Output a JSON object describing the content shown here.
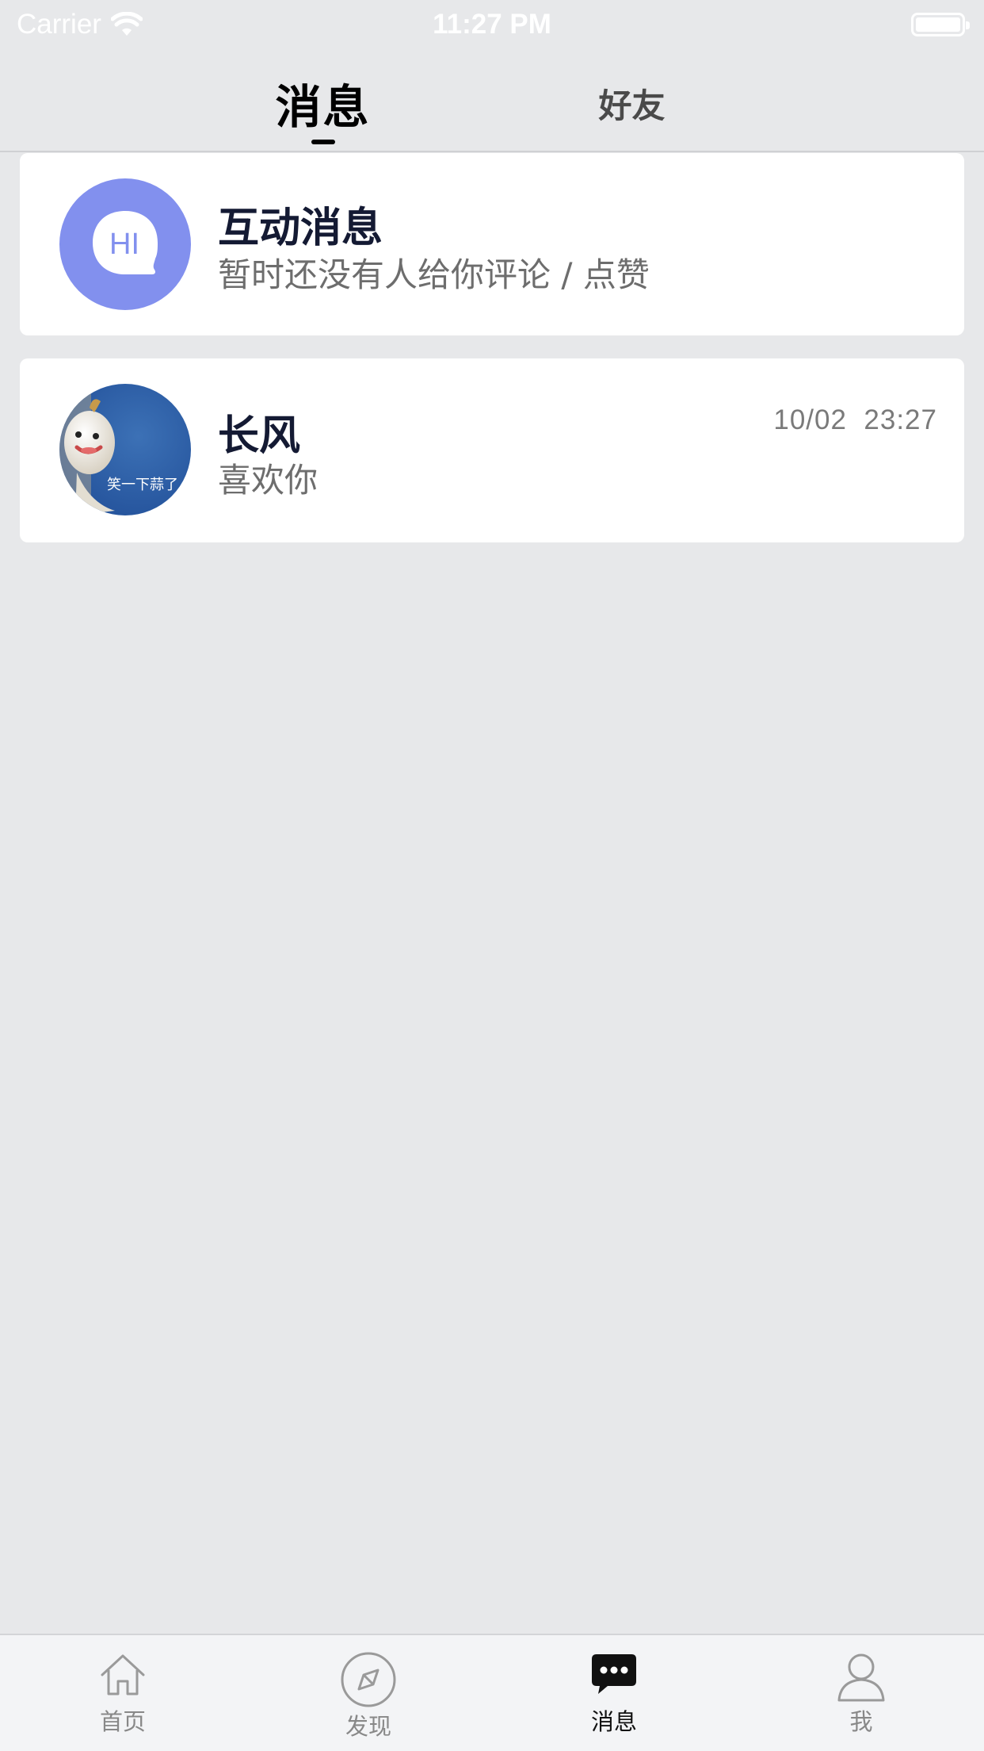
{
  "status_bar": {
    "carrier": "Carrier",
    "time": "11:27 PM"
  },
  "top_tabs": [
    {
      "label": "消息",
      "active": true
    },
    {
      "label": "好友",
      "active": false
    }
  ],
  "interaction_card": {
    "icon": "hi-bubble-icon",
    "icon_text": "HI",
    "title": "互动消息",
    "subtitle": "暂时还没有人给你评论 / 点赞"
  },
  "chat_card": {
    "name": "长风",
    "last_message": "喜欢你",
    "date": "10/02",
    "time": "23:27",
    "avatar_caption": "笑一下蒜了"
  },
  "tab_bar": [
    {
      "label": "首页",
      "icon": "home-icon",
      "active": false
    },
    {
      "label": "发现",
      "icon": "compass-icon",
      "active": false
    },
    {
      "label": "消息",
      "icon": "chat-bubble-icon",
      "active": true
    },
    {
      "label": "我",
      "icon": "person-icon",
      "active": false
    }
  ],
  "colors": {
    "background": "#e7e8ea",
    "hi_avatar": "#8290ee",
    "title": "#141a33",
    "subtitle": "#6d6d6d",
    "active_tab": "#111111",
    "inactive_tab": "#888888"
  }
}
